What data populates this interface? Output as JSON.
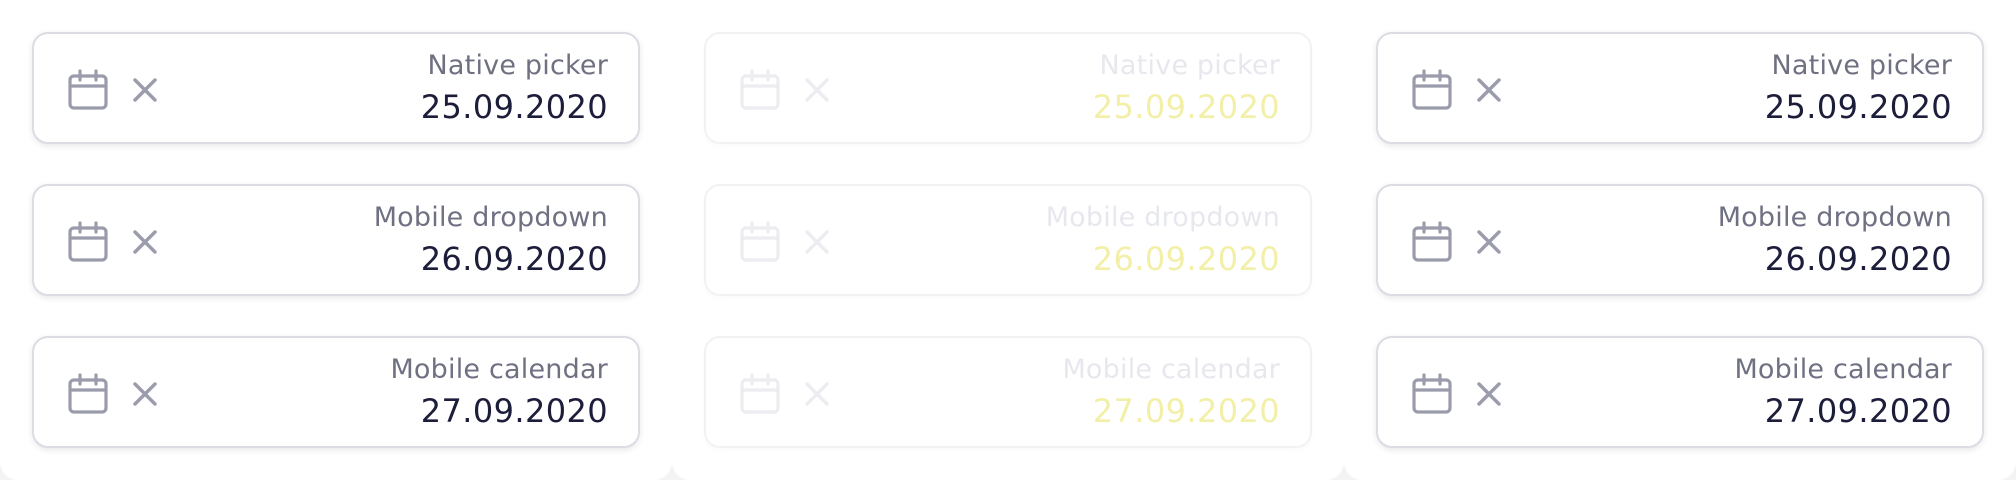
{
  "panels": [
    {
      "fields": [
        {
          "label": "Native picker",
          "value": "25.09.2020"
        },
        {
          "label": "Mobile dropdown",
          "value": "26.09.2020"
        },
        {
          "label": "Mobile calendar",
          "value": "27.09.2020"
        }
      ]
    },
    {
      "state": "disabled",
      "fields": [
        {
          "label": "Native picker",
          "value": "25.09.2020"
        },
        {
          "label": "Mobile dropdown",
          "value": "26.09.2020"
        },
        {
          "label": "Mobile calendar",
          "value": "27.09.2020"
        }
      ]
    },
    {
      "fields": [
        {
          "label": "Native picker",
          "value": "25.09.2020"
        },
        {
          "label": "Mobile dropdown",
          "value": "26.09.2020"
        },
        {
          "label": "Mobile calendar",
          "value": "27.09.2020"
        }
      ]
    }
  ],
  "icons": {
    "calendar": "calendar-icon",
    "clear": "close-icon"
  },
  "colors": {
    "label": "#6f7183",
    "value": "#1b1d3a",
    "icon": "#9a9bab",
    "border": "#dcdde3",
    "disabled_value": "#f2f0a8"
  }
}
